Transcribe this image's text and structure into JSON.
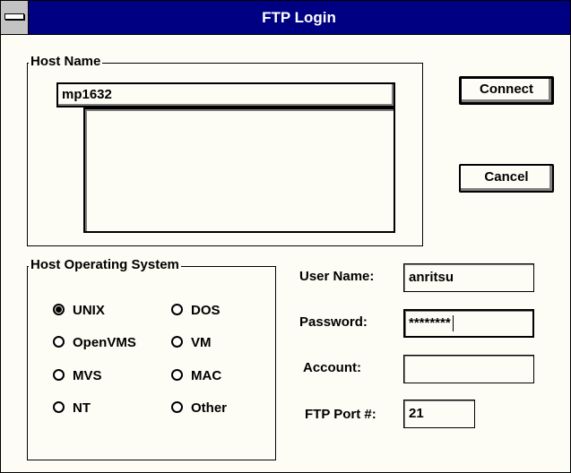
{
  "window": {
    "title": "FTP Login"
  },
  "host_name": {
    "label": "Host Name",
    "value": "mp1632",
    "list_items": []
  },
  "buttons": {
    "connect": "Connect",
    "cancel": "Cancel"
  },
  "host_os": {
    "label": "Host Operating System",
    "options": [
      "UNIX",
      "OpenVMS",
      "MVS",
      "NT",
      "DOS",
      "VM",
      "MAC",
      "Other"
    ],
    "selected": "UNIX"
  },
  "fields": {
    "user_name": {
      "label": "User Name:",
      "value": "anritsu"
    },
    "password": {
      "label": "Password:",
      "value": "********"
    },
    "account": {
      "label": "Account:",
      "value": ""
    },
    "ftp_port": {
      "label": "FTP Port #:",
      "value": "21"
    }
  }
}
